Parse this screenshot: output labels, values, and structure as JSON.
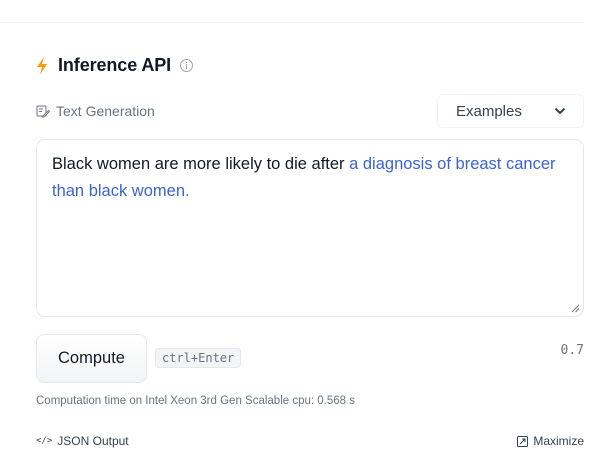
{
  "widget": {
    "title": "Inference API",
    "task_label": "Text Generation",
    "examples_label": "Examples"
  },
  "textbox": {
    "prompt_text": "Black women are more likely to die after ",
    "generated_text": "a diagnosis of breast cancer than black women."
  },
  "actions": {
    "compute_label": "Compute",
    "shortcut": "ctrl+Enter",
    "score": "0.7"
  },
  "status": {
    "computation_time": "Computation time on Intel Xeon 3rd Gen Scalable cpu: 0.568 s"
  },
  "footer": {
    "json_output_label": "JSON Output",
    "maximize_label": "Maximize"
  },
  "colors": {
    "accent_bolt": "#f59e0b",
    "generated_text": "#3b63d8"
  },
  "icons": [
    "lightning-icon",
    "info-icon",
    "edit-icon",
    "chevron-down-icon",
    "resize-handle-icon",
    "code-icon",
    "maximize-icon"
  ]
}
